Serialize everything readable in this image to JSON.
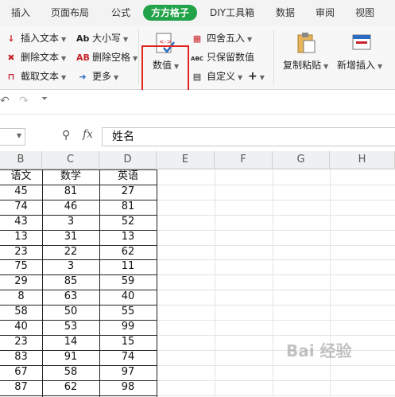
{
  "menu": [
    "插入",
    "页面布局",
    "公式",
    "方方格子",
    "DIY工具箱",
    "数据",
    "审阅",
    "视图"
  ],
  "ribbon": {
    "insert_text": "插入文本",
    "delete_text": "删除文本",
    "extract_text": "截取文本",
    "case": "大小写",
    "delete_space": "删除空格",
    "more": "更多",
    "numeric": "数值",
    "round": "四舍五入",
    "keep_numeric": "只保留数值",
    "custom": "自定义",
    "plus": "+",
    "copy_paste": "复制粘贴",
    "new_insert": "新增插入"
  },
  "formula_bar": {
    "fx": "fx",
    "value": "姓名"
  },
  "columns": [
    "B",
    "C",
    "D",
    "E",
    "F",
    "G",
    "H"
  ],
  "table": {
    "headers": [
      "语文",
      "数学",
      "英语"
    ],
    "rows": [
      [
        "45",
        "81",
        "27"
      ],
      [
        "74",
        "46",
        "81"
      ],
      [
        "43",
        "3",
        "52"
      ],
      [
        "13",
        "31",
        "13"
      ],
      [
        "23",
        "22",
        "62"
      ],
      [
        "75",
        "3",
        "11"
      ],
      [
        "29",
        "85",
        "59"
      ],
      [
        "8",
        "63",
        "40"
      ],
      [
        "58",
        "50",
        "55"
      ],
      [
        "40",
        "53",
        "99"
      ],
      [
        "23",
        "14",
        "15"
      ],
      [
        "83",
        "91",
        "74"
      ],
      [
        "67",
        "58",
        "97"
      ],
      [
        "87",
        "62",
        "98"
      ]
    ]
  },
  "watermark": "Bai 经验",
  "colors": {
    "active_tab": "#22a249",
    "highlight": "#e0251f"
  }
}
